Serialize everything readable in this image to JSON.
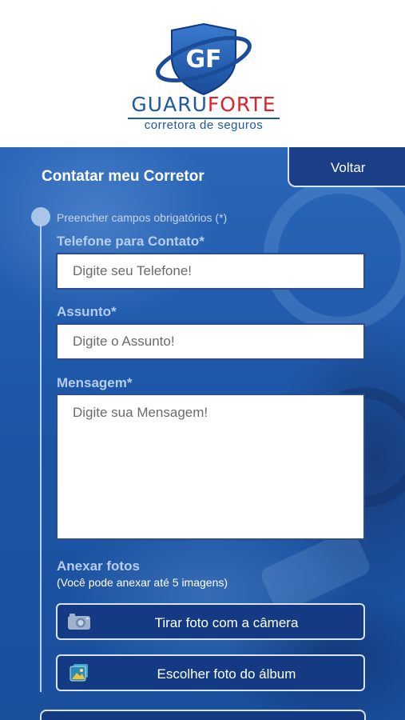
{
  "brand": {
    "monogram": "GF",
    "name_part1": "GUARU",
    "name_part2": "FORTE",
    "tagline": "corretora de seguros",
    "colors": {
      "blue": "#1d57a8",
      "red": "#e1222a"
    }
  },
  "page": {
    "title": "Contatar meu Corretor",
    "back_label": "Voltar",
    "required_note": "Preencher campos obrigatórios (*)"
  },
  "form": {
    "phone": {
      "label": "Telefone para Contato*",
      "placeholder": "Digite seu Telefone!",
      "value": ""
    },
    "subject": {
      "label": "Assunto*",
      "placeholder": "Digite o Assunto!",
      "value": ""
    },
    "message": {
      "label": "Mensagem*",
      "placeholder": "Digite sua Mensagem!",
      "value": ""
    }
  },
  "attachments": {
    "title": "Anexar fotos",
    "hint": "(Você pode anexar até 5 imagens)",
    "camera_button": {
      "label": "Tirar foto com a câmera",
      "icon": "camera-icon"
    },
    "album_button": {
      "label": "Escolher foto do álbum",
      "icon": "photo-album-icon"
    }
  },
  "colors": {
    "background_blue": "#1d56a6",
    "button_navy": "#133a82",
    "label_light_blue": "#b6cdee"
  }
}
